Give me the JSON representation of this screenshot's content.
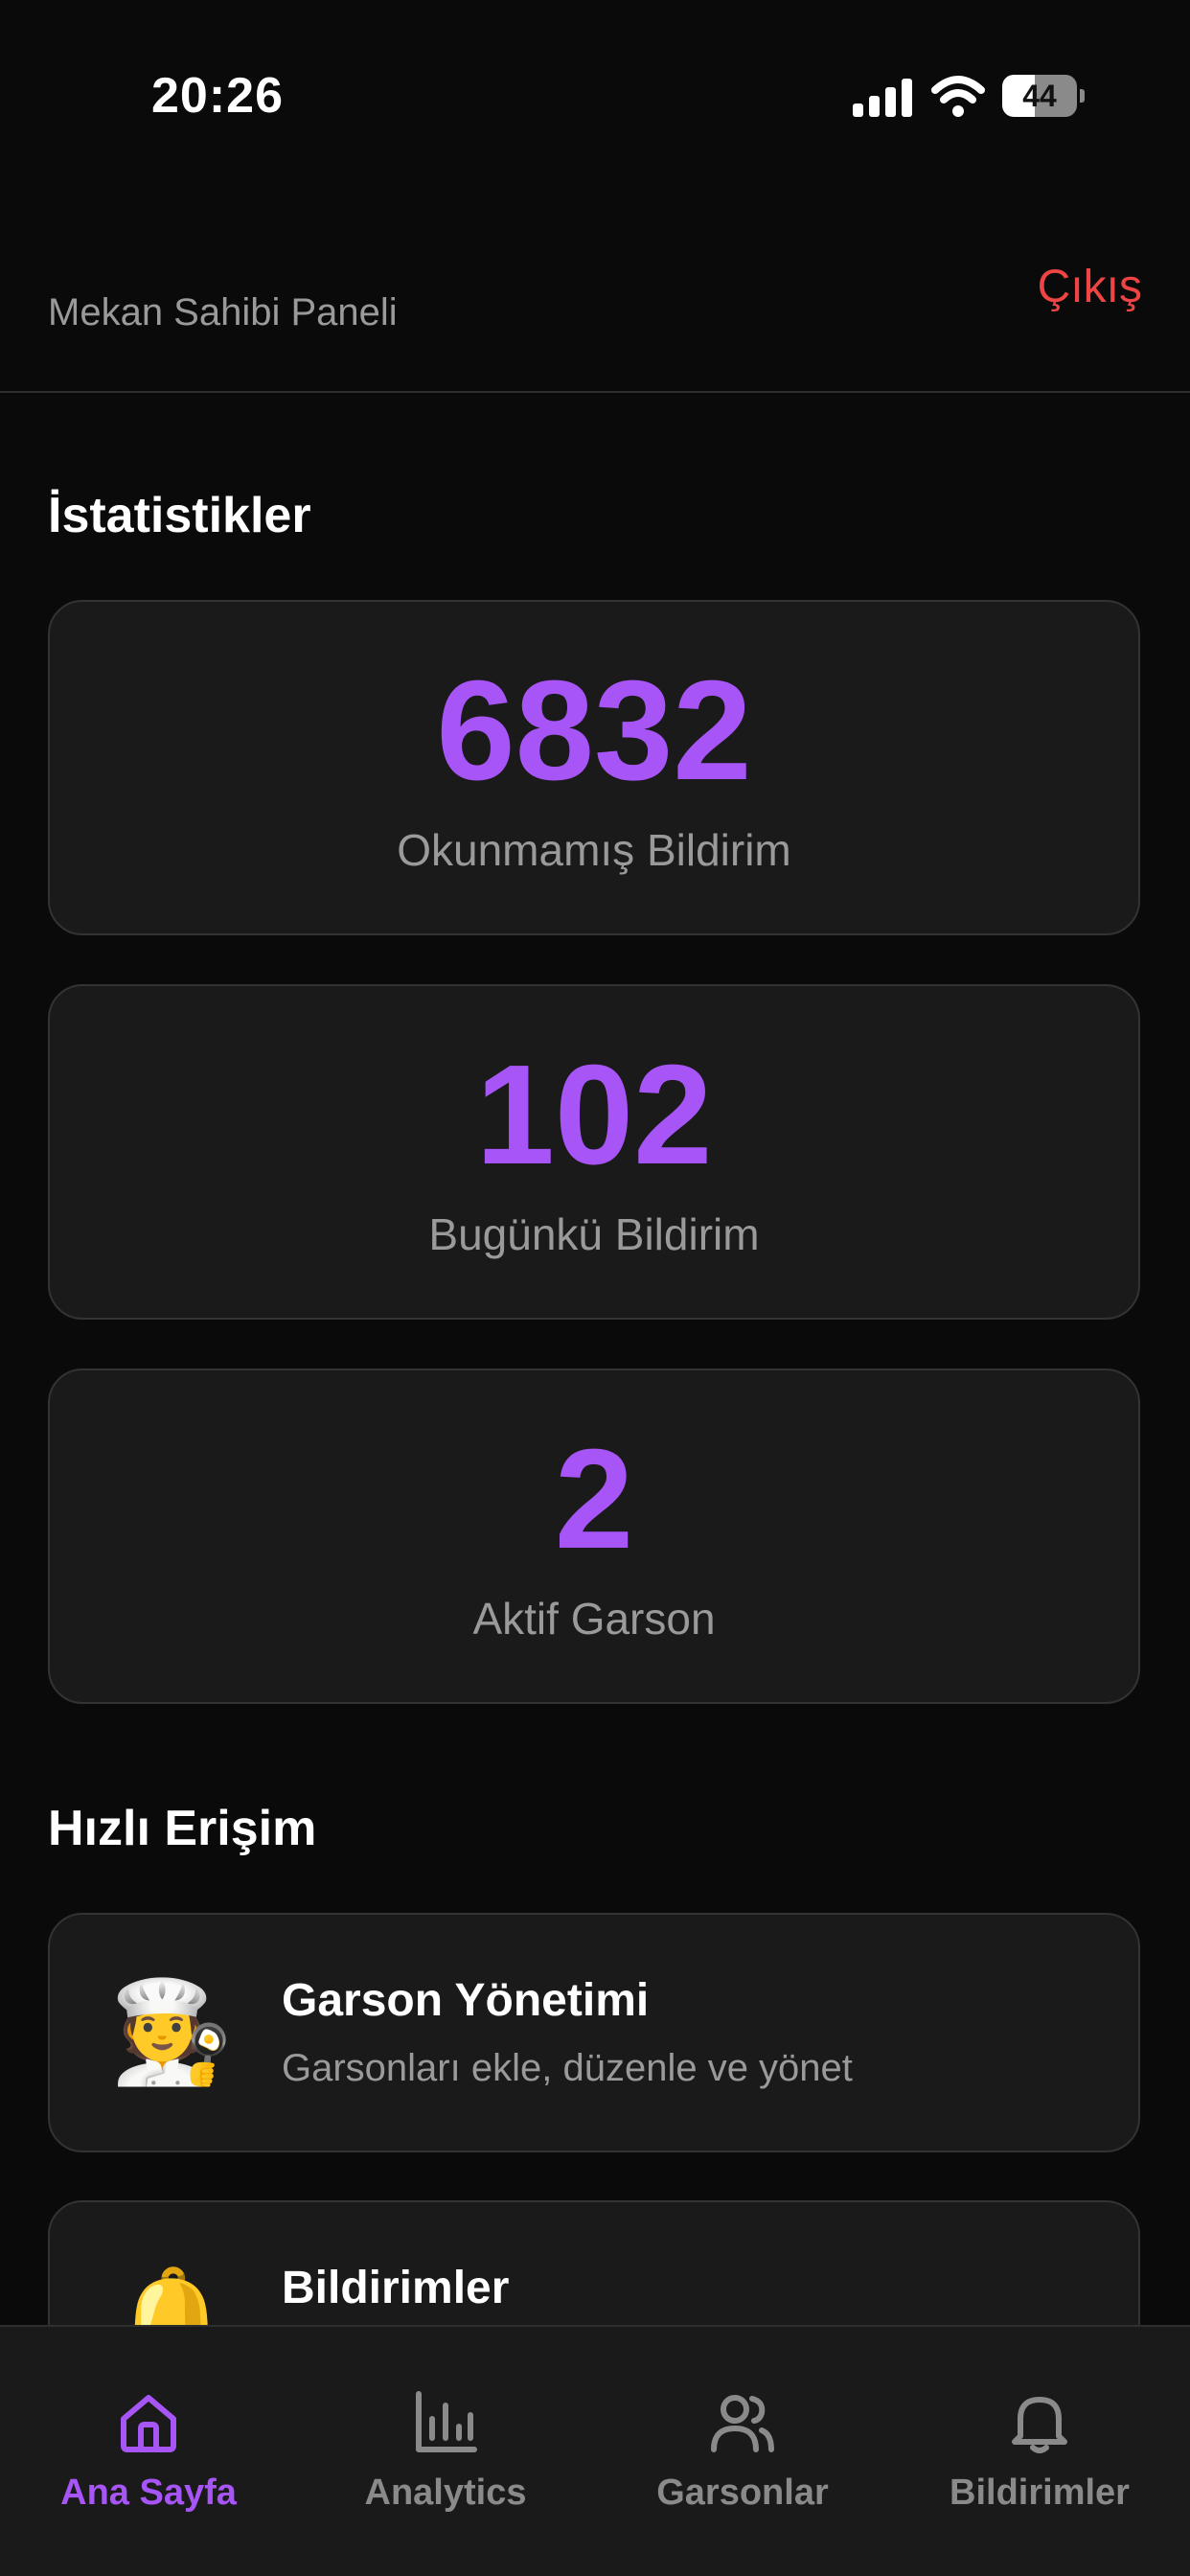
{
  "status_bar": {
    "time": "20:26",
    "battery_level": "44",
    "battery_fraction": 0.44
  },
  "header": {
    "subtitle": "Mekan Sahibi Paneli",
    "logout_label": "Çıkış"
  },
  "stats": {
    "title": "İstatistikler",
    "items": [
      {
        "value": "6832",
        "label": "Okunmamış Bildirim"
      },
      {
        "value": "102",
        "label": "Bugünkü Bildirim"
      },
      {
        "value": "2",
        "label": "Aktif Garson"
      }
    ]
  },
  "quick_access": {
    "title": "Hızlı Erişim",
    "items": [
      {
        "emoji": "🧑‍🍳",
        "icon": "chef-icon",
        "title": "Garson Yönetimi",
        "description": "Garsonları ekle, düzenle ve yönet"
      },
      {
        "emoji": "🔔",
        "icon": "bell-icon",
        "title": "Bildirimler",
        "description": ""
      }
    ]
  },
  "tab_bar": {
    "items": [
      {
        "label": "Ana Sayfa",
        "icon": "home-icon",
        "active": true
      },
      {
        "label": "Analytics",
        "icon": "bar-chart-icon",
        "active": false
      },
      {
        "label": "Garsonlar",
        "icon": "users-icon",
        "active": false
      },
      {
        "label": "Bildirimler",
        "icon": "bell-icon",
        "active": false
      }
    ]
  },
  "colors": {
    "accent": "#a855f7",
    "danger": "#ef4444",
    "background": "#0a0a0a",
    "card": "#1a1a1a",
    "muted_text": "#9a9a9a"
  }
}
